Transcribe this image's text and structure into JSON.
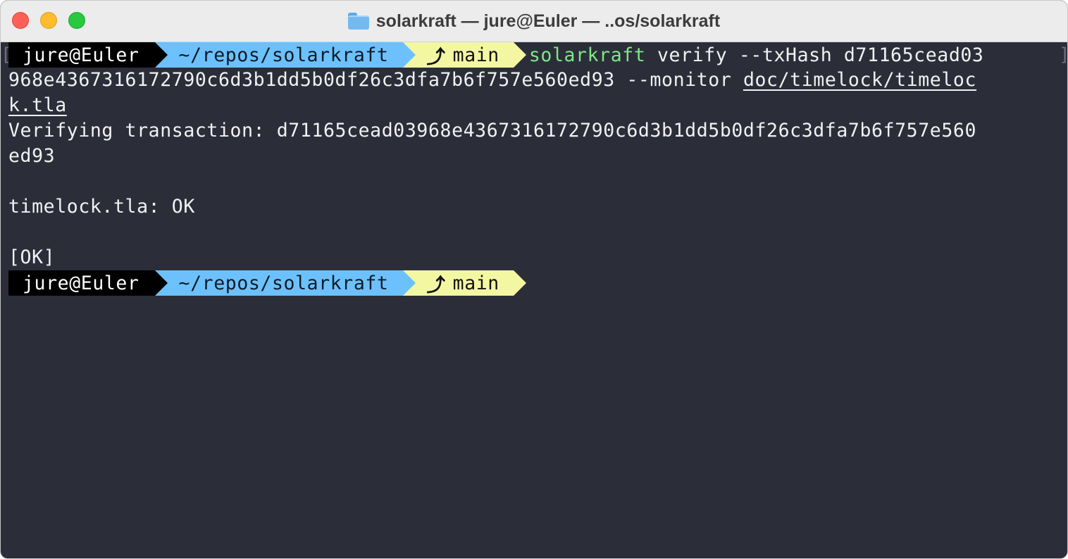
{
  "window": {
    "title": "solarkraft — jure@Euler — ..os/solarkraft"
  },
  "prompt": {
    "user": "jure@Euler",
    "path": "~/repos/solarkraft",
    "branch": "main"
  },
  "command": {
    "program": "solarkraft",
    "line1_args": " verify --txHash d71165cead03",
    "line2_args": "968e4367316172790c6d3b1dd5b0df26c3dfa7b6f757e560ed93 --monitor ",
    "line2_file": "doc/timelock/timeloc",
    "line3_file": "k.tla"
  },
  "output": {
    "line1": "Verifying transaction: d71165cead03968e4367316172790c6d3b1dd5b0df26c3dfa7b6f757e560",
    "line2": "ed93",
    "line3": "timelock.tla: OK",
    "line4": "[OK]"
  },
  "icons": {
    "folder": "folder-icon",
    "branch": "git-branch-icon"
  },
  "colors": {
    "background": "#2b2e39",
    "user_segment": "#000000",
    "path_segment": "#6cc1fc",
    "git_segment": "#f4f7a2",
    "command_name": "#7ee787"
  }
}
